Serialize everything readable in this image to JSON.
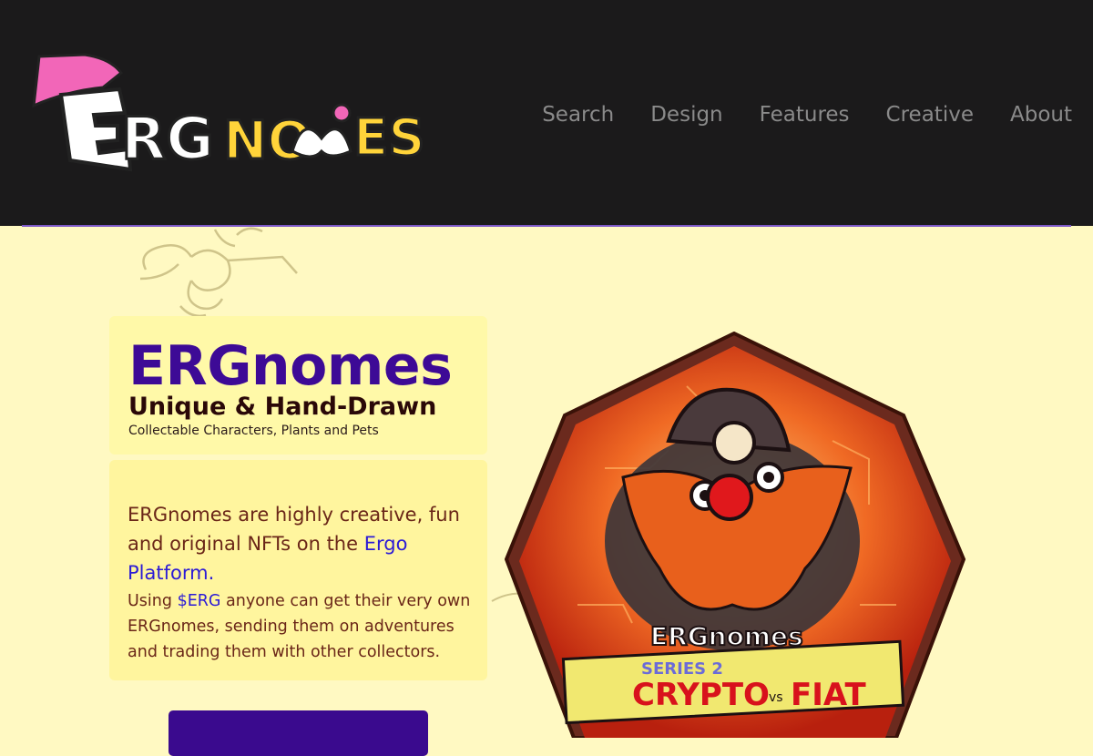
{
  "header": {
    "logo_alt": "ERGnomes",
    "nav": [
      {
        "label": "Search"
      },
      {
        "label": "Design"
      },
      {
        "label": "Features"
      },
      {
        "label": "Creative"
      },
      {
        "label": "About"
      }
    ]
  },
  "hero": {
    "title": "ERGnomes",
    "subtitle": "Unique & Hand-Drawn",
    "tagline": "Collectable Characters, Plants and Pets",
    "desc_prefix": "ERGnomes are highly creative, fun and original NFTs on the ",
    "desc_link": "Ergo Platform.",
    "desc2_prefix": "Using ",
    "desc2_link": "$ERG",
    "desc2_suffix": " anyone can get their very own ERGnomes, sending them on adventures and trading them with other collectors.",
    "cta_label": ""
  },
  "badge": {
    "logo_text": "ERGnomes",
    "series": "SERIES 2",
    "theme_left": "CRYPTO",
    "theme_vs": "vs",
    "theme_right": "FIAT"
  },
  "colors": {
    "header_bg": "#1b1a1b",
    "page_bg": "#fff9c2",
    "accent_purple": "#3d0a96",
    "link_blue": "#2c1bd6",
    "nav_text": "#8a8a8a"
  }
}
